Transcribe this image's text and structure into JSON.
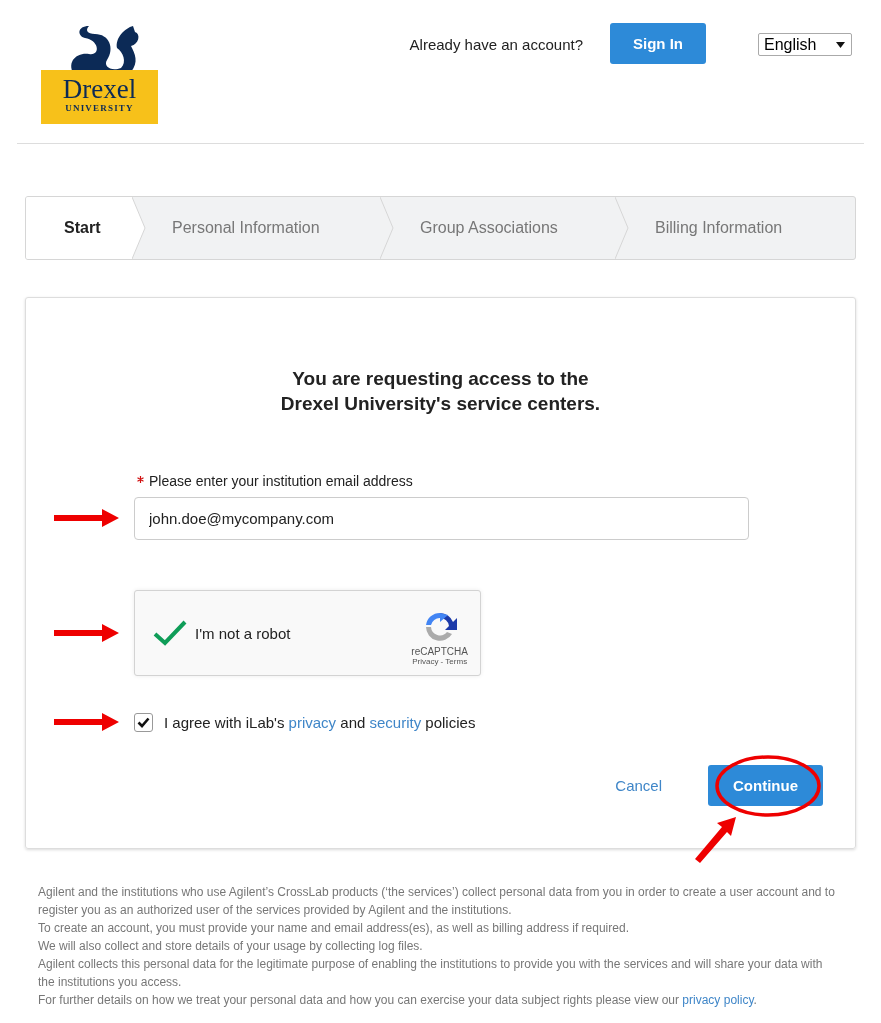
{
  "logo": {
    "name": "Drexel",
    "subtitle": "UNIVERSITY"
  },
  "header": {
    "prompt": "Already have an account?",
    "sign_in": "Sign In",
    "language": "English"
  },
  "steps": [
    {
      "label": "Start",
      "selected": true
    },
    {
      "label": "Personal Information",
      "selected": false
    },
    {
      "label": "Group Associations",
      "selected": false
    },
    {
      "label": "Billing Information",
      "selected": false
    }
  ],
  "form": {
    "heading_lines": [
      "You are requesting access to the",
      "Drexel University's service centers."
    ],
    "email": {
      "required": true,
      "label": "Please enter your institution email address",
      "value": "john.doe@mycompany.com",
      "marked": true
    },
    "captcha": {
      "checked": true,
      "label": "I'm not a robot",
      "brand": "reCAPTCHA",
      "links": "Privacy - Terms",
      "marked": true
    },
    "agree": {
      "checked": true,
      "parts": [
        {
          "text": "I agree with iLab's "
        },
        {
          "text": "privacy",
          "link": true
        },
        {
          "text": " and "
        },
        {
          "text": "security",
          "link": true
        },
        {
          "text": " policies"
        }
      ],
      "marked": true
    },
    "cancel": "Cancel",
    "continue": {
      "label": "Continue",
      "circled": true
    }
  },
  "footer": {
    "lines": [
      {
        "parts": [
          {
            "text": "Agilent and the institutions who use Agilent’s CrossLab products (‘the services’) collect personal data from you in order to create a user account and to register you as an authorized user of the services provided by Agilent and the institutions."
          }
        ]
      },
      {
        "parts": [
          {
            "text": "To create an account, you must provide your name and email address(es), as well as billing address if required."
          }
        ]
      },
      {
        "parts": [
          {
            "text": "We will also collect and store details of your usage by collecting log files."
          }
        ]
      },
      {
        "parts": [
          {
            "text": "Agilent collects this personal data for the legitimate purpose of enabling the institutions to provide you with the services and will share your data with the institutions you access."
          }
        ]
      },
      {
        "parts": [
          {
            "text": "For further details on how we treat your personal data and how you can exercise your data subject rights please view our "
          },
          {
            "text": "privacy policy",
            "link": true
          },
          {
            "text": "."
          }
        ]
      }
    ]
  }
}
